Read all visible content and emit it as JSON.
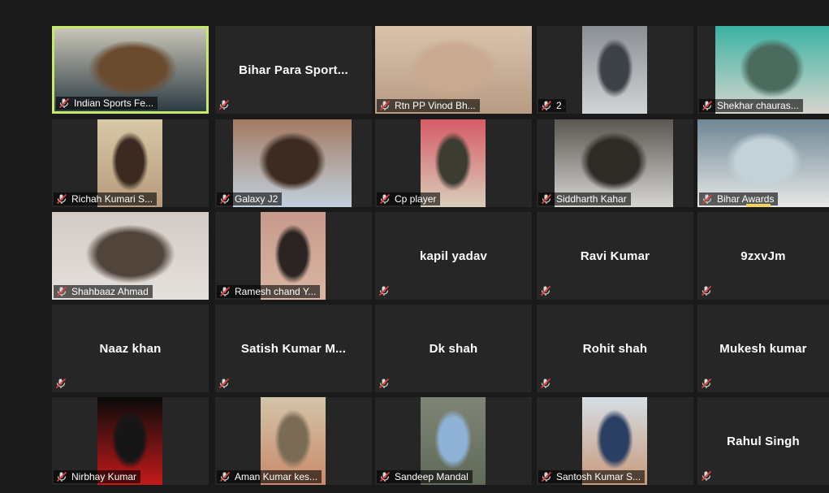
{
  "participants": [
    {
      "label": "Indian Sports Fe...",
      "video": true,
      "active": true,
      "colors": [
        "#c9c6b8",
        "#6b4b2e",
        "#2d3b44"
      ]
    },
    {
      "name": "Bihar Para Sport...",
      "video": false
    },
    {
      "label": "Rtn PP Vinod Bh...",
      "video": true,
      "colors": [
        "#d9c3ad",
        "#c9a98f",
        "#b89b83"
      ]
    },
    {
      "label": "2",
      "video": true,
      "colors": [
        "#8a8f94",
        "#3d4248",
        "#d0d4d6"
      ]
    },
    {
      "label": "Shekhar  chauras...",
      "video": true,
      "colors": [
        "#3ab3a3",
        "#4a6b5d",
        "#d7d5ce"
      ]
    },
    {
      "label": "Richah Kumari S...",
      "video": true,
      "colors": [
        "#d8c8a6",
        "#3a2a20",
        "#b69a7b"
      ]
    },
    {
      "label": "Galaxy J2",
      "video": true,
      "colors": [
        "#a37a61",
        "#3d2a20",
        "#c1d1de"
      ]
    },
    {
      "label": "Cp player",
      "video": true,
      "colors": [
        "#d65b67",
        "#3c3c32",
        "#d9cdb9"
      ]
    },
    {
      "label": "Siddharth Kahar",
      "video": true,
      "colors": [
        "#5b5752",
        "#2e2a26",
        "#d7d6d2"
      ]
    },
    {
      "label": "Bihar Awards",
      "video": true,
      "colors": [
        "#6f8796",
        "#c2d2d8",
        "#e6e8e6"
      ]
    },
    {
      "label": "Shahbaaz Ahmad",
      "video": true,
      "colors": [
        "#d3cbc4",
        "#51443b",
        "#e4e0dc"
      ]
    },
    {
      "label": "Ramesh chand Y...",
      "video": true,
      "colors": [
        "#c79a8c",
        "#2b2422",
        "#d9b6a3"
      ]
    },
    {
      "name": "kapil yadav",
      "video": false
    },
    {
      "name": "Ravi Kumar",
      "video": false
    },
    {
      "name": "9zxvJm",
      "video": false
    },
    {
      "name": "Naaz khan",
      "video": false
    },
    {
      "name": "Satish  Kumar M...",
      "video": false
    },
    {
      "name": "Dk shah",
      "video": false
    },
    {
      "name": "Rohit shah",
      "video": false
    },
    {
      "name": "Mukesh kumar",
      "video": false
    },
    {
      "label": "Nirbhay Kumar",
      "video": true,
      "colors": [
        "#0a0a0a",
        "#161616",
        "#c41a1a"
      ]
    },
    {
      "label": "Aman Kumar kes...",
      "video": true,
      "colors": [
        "#d3c4a8",
        "#7a6b55",
        "#c98a6a"
      ]
    },
    {
      "label": "Sandeep Mandal",
      "video": true,
      "colors": [
        "#7f8576",
        "#8fb3d6",
        "#606a58"
      ]
    },
    {
      "label": "Santosh Kumar S...",
      "video": true,
      "colors": [
        "#d5dde4",
        "#2a3f63",
        "#c99a7a"
      ]
    },
    {
      "name": "Rahul Singh",
      "video": false
    }
  ]
}
